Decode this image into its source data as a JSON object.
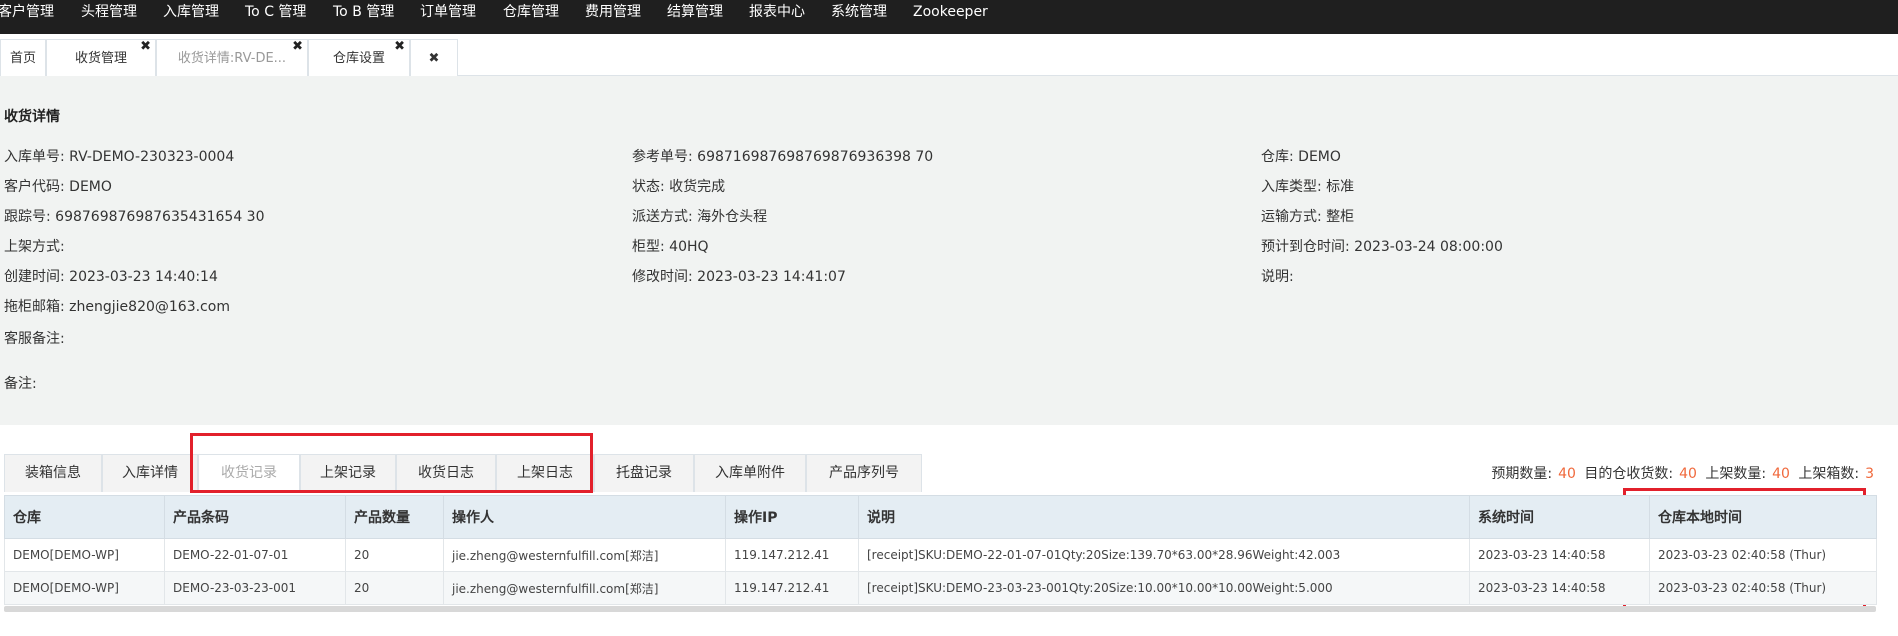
{
  "topnav": {
    "items": [
      "客户管理",
      "头程管理",
      "入库管理",
      "To C 管理",
      "To B 管理",
      "订单管理",
      "仓库管理",
      "费用管理",
      "结算管理",
      "报表中心",
      "系统管理",
      "Zookeeper"
    ]
  },
  "tabs": [
    {
      "label": "首页",
      "closable": false
    },
    {
      "label": "收货管理",
      "closable": true
    },
    {
      "label": "收货详情:RV-DE...",
      "closable": true,
      "active": true
    },
    {
      "label": "仓库设置",
      "closable": true
    }
  ],
  "close_all_icon": "✖",
  "tab_close_icon": "✖",
  "detail": {
    "title": "收货详情",
    "fields": {
      "inbound_no": {
        "label": "入库单号:",
        "value": "RV-DEMO-230323-0004"
      },
      "ref_no": {
        "label": "参考单号:",
        "value": "698716987698769876936398 70"
      },
      "warehouse": {
        "label": "仓库:",
        "value": "DEMO"
      },
      "customer_code": {
        "label": "客户代码:",
        "value": "DEMO"
      },
      "status": {
        "label": "状态:",
        "value": "收货完成"
      },
      "inbound_type": {
        "label": "入库类型:",
        "value": "标准"
      },
      "tracking_no": {
        "label": "跟踪号:",
        "value": "698769876987635431654 30"
      },
      "delivery_method": {
        "label": "派送方式:",
        "value": "海外仓头程"
      },
      "transport_method": {
        "label": "运输方式:",
        "value": "整柜"
      },
      "putaway_method": {
        "label": "上架方式:",
        "value": ""
      },
      "container_type": {
        "label": "柜型:",
        "value": "40HQ"
      },
      "eta": {
        "label": "预计到仓时间:",
        "value": "2023-03-24 08:00:00"
      },
      "created_at": {
        "label": "创建时间:",
        "value": "2023-03-23 14:40:14"
      },
      "modified_at": {
        "label": "修改时间:",
        "value": "2023-03-23 14:41:07"
      },
      "description": {
        "label": "说明:",
        "value": ""
      },
      "tow_email": {
        "label": "拖柜邮箱:",
        "value": "zhengjie820@163.com"
      },
      "cs_remark": {
        "label": "客服备注:",
        "value": ""
      },
      "remark": {
        "label": "备注:",
        "value": ""
      }
    }
  },
  "subtabs": [
    "装箱信息",
    "入库详情",
    "收货记录",
    "上架记录",
    "收货日志",
    "上架日志",
    "托盘记录",
    "入库单附件",
    "产品序列号"
  ],
  "active_subtab": "收货记录",
  "counts": {
    "expected_label": "预期数量:",
    "expected_value": "40",
    "received_label": "目的仓收货数:",
    "received_value": "40",
    "putaway_label": "上架数量:",
    "putaway_value": "40",
    "putaway_boxes_label": "上架箱数:",
    "putaway_boxes_value": "3"
  },
  "table": {
    "columns": [
      "仓库",
      "产品条码",
      "产品数量",
      "操作人",
      "操作IP",
      "说明",
      "系统时间",
      "仓库本地时间"
    ],
    "rows": [
      [
        "DEMO[DEMO-WP]",
        "DEMO-22-01-07-01",
        "20",
        "jie.zheng@westernfulfill.com[郑洁]",
        "119.147.212.41",
        "[receipt]SKU:DEMO-22-01-07-01Qty:20Size:139.70*63.00*28.96Weight:42.003",
        "2023-03-23 14:40:58",
        "2023-03-23 02:40:58 (Thur)"
      ],
      [
        "DEMO[DEMO-WP]",
        "DEMO-23-03-23-001",
        "20",
        "jie.zheng@westernfulfill.com[郑洁]",
        "119.147.212.41",
        "[receipt]SKU:DEMO-23-03-23-001Qty:20Size:10.00*10.00*10.00Weight:5.000",
        "2023-03-23 14:40:58",
        "2023-03-23 02:40:58 (Thur)"
      ]
    ]
  },
  "colors": {
    "topnav_bg": "#1f1f1f",
    "detail_bg": "#f1f3f2",
    "highlight_red": "#e2202b",
    "count_orange": "#f0693c",
    "table_header_bg": "#e4edf3"
  }
}
